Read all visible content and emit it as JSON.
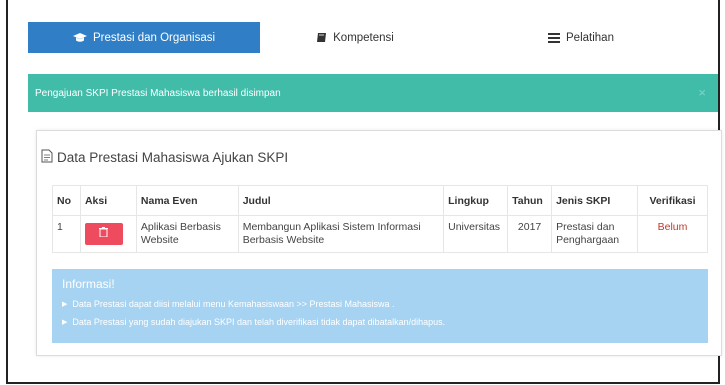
{
  "tabs": [
    {
      "label": "Prestasi dan Organisasi",
      "icon": "graduation-cap-icon",
      "active": true
    },
    {
      "label": "Kompetensi",
      "icon": "book-icon",
      "active": false
    },
    {
      "label": "Pelatihan",
      "icon": "list-icon",
      "active": false
    }
  ],
  "alert": {
    "message": "Pengajuan SKPI Prestasi Mahasiswa berhasil disimpan",
    "close": "×"
  },
  "panel": {
    "title": "Data Prestasi Mahasiswa Ajukan SKPI"
  },
  "table": {
    "headers": [
      "No",
      "Aksi",
      "Nama Even",
      "Judul",
      "Lingkup",
      "Tahun",
      "Jenis SKPI",
      "Verifikasi"
    ],
    "rows": [
      {
        "no": "1",
        "nama_even": "Aplikasi Berbasis Website",
        "judul": "Membangun Aplikasi Sistem Informasi Berbasis Website",
        "lingkup": "Universitas",
        "tahun": "2017",
        "jenis_skpi": "Prestasi dan Penghargaan",
        "verifikasi": "Belum"
      }
    ]
  },
  "info": {
    "title": "Informasi!",
    "items": [
      "Data Prestasi dapat diisi melalui menu Kemahasiswaan >> Prestasi Mahasiswa .",
      "Data Prestasi yang sudah diajukan SKPI dan telah diverifikasi tidak dapat dibatalkan/dihapus."
    ]
  },
  "colors": {
    "tab_active": "#2f7ec6",
    "alert": "#40bca9",
    "delete_button": "#ee4b5e",
    "info_box": "#a6d3f2",
    "status_belum": "#c0392b"
  }
}
